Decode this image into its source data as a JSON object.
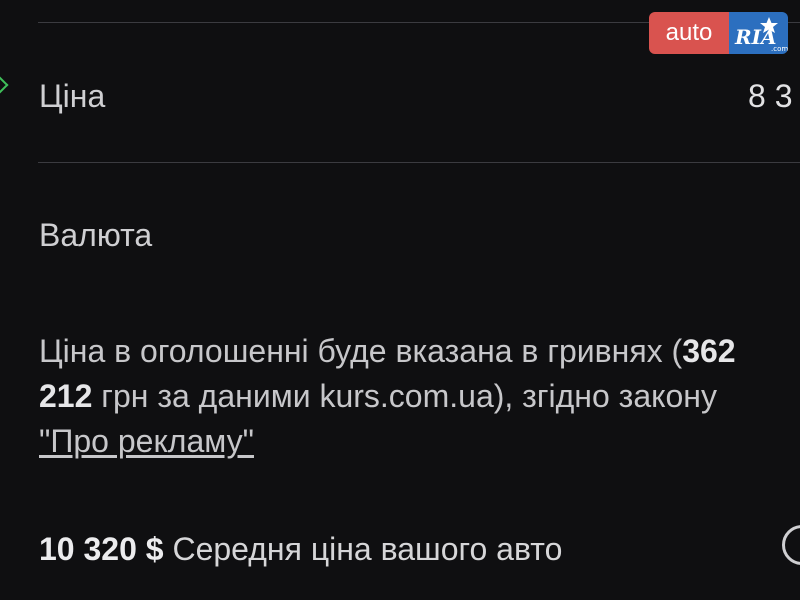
{
  "logo": {
    "auto_text": "auto",
    "ria_text": "RIA",
    "ria_sub": ".com",
    "colors": {
      "auto_bg": "#d9534f",
      "ria_bg": "#2c6fbf"
    }
  },
  "price_row": {
    "label": "Ціна",
    "value": "8 3"
  },
  "currency_row": {
    "label": "Валюта"
  },
  "note": {
    "text_before": "Ціна в оголошенні буде вказана в гривнях (",
    "uah_amount": "362 212",
    "text_middle": " грн за даними kurs.com.ua), згідно закону ",
    "law_link": "\"Про рекламу\""
  },
  "average_price": {
    "amount": "10 320 $",
    "label": " Середня ціна вашого авто"
  },
  "icons": {
    "marker": "chevron-right-icon",
    "info": "info-icon"
  }
}
